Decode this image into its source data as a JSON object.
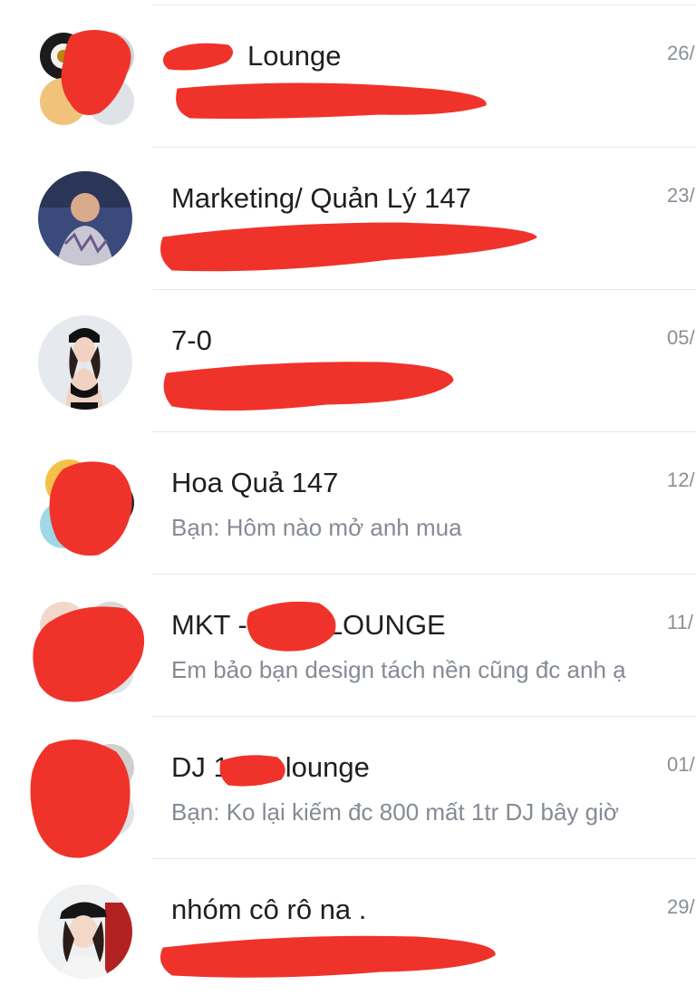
{
  "conversations": [
    {
      "name": "Lounge",
      "preview": "",
      "time": "26/",
      "avatar": "group-avatar"
    },
    {
      "name": "Marketing/ Quản Lý 147",
      "preview": "",
      "time": "23/",
      "avatar": "person-avatar"
    },
    {
      "name": "7-0",
      "preview": "",
      "time": "05/",
      "avatar": "person-avatar"
    },
    {
      "name": "Hoa Quả 147",
      "preview": "Bạn: Hôm nào mở anh mua",
      "time": "12/",
      "avatar": "group-avatar"
    },
    {
      "name_prefix": "MKT -",
      "name_suffix": "LOUNGE",
      "preview": "Em bảo bạn design tách nền cũng đc anh ạ",
      "time": "11/",
      "avatar": "group-avatar"
    },
    {
      "name_prefix": "DJ 1",
      "name_suffix": "lounge",
      "preview": "Bạn: Ko lại kiếm đc 800 mất 1tr DJ bây giờ",
      "time": "01/",
      "avatar": "group-avatar"
    },
    {
      "name": "nhóm cô rô na .",
      "preview": "",
      "time": "29/",
      "avatar": "person-avatar"
    }
  ],
  "colors": {
    "redaction": "#f0332a",
    "name_text": "#1f1f1f",
    "preview_text": "#858b94",
    "time_text": "#8a8f96",
    "separator": "#e8e8e8"
  }
}
